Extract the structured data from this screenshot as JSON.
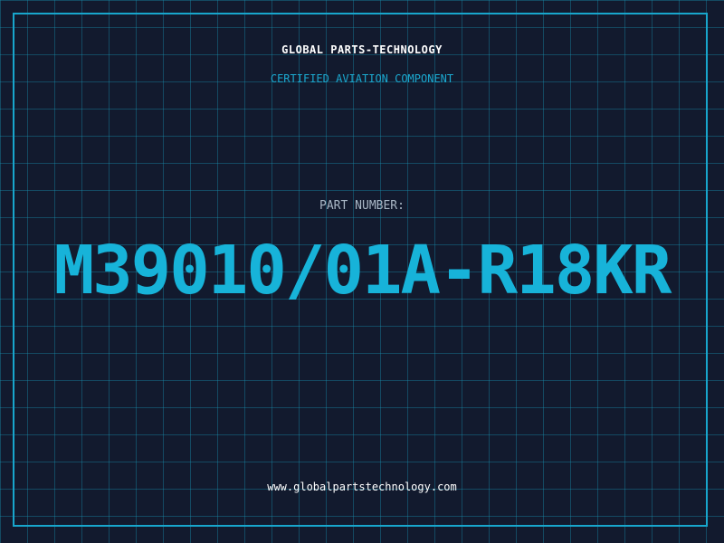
{
  "header": {
    "company_name": "GLOBAL PARTS-TECHNOLOGY",
    "tagline": "CERTIFIED AVIATION COMPONENT"
  },
  "part": {
    "label": "PART NUMBER:",
    "number": "M39010/01A-R18KR"
  },
  "footer": {
    "website": "www.globalpartstechnology.com"
  },
  "colors": {
    "background": "#121a2e",
    "accent": "#17b3d9",
    "grid": "#1896b4"
  }
}
